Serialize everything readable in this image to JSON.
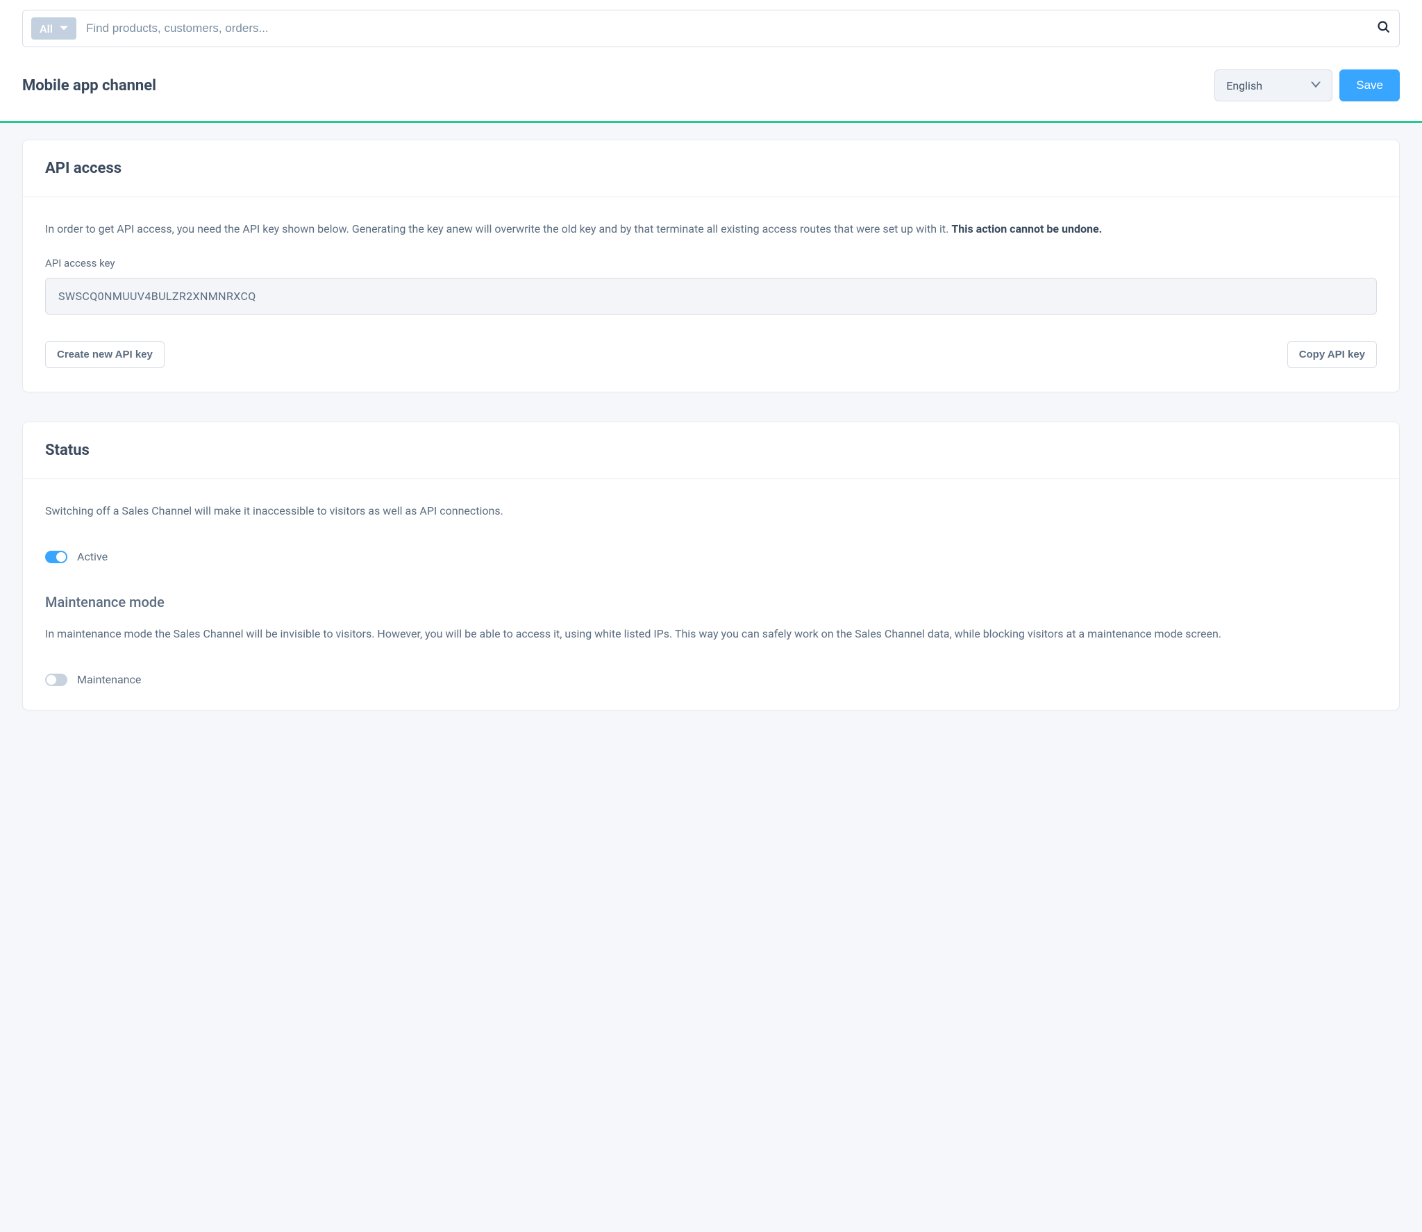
{
  "search": {
    "filter_label": "All",
    "placeholder": "Find products, customers, orders..."
  },
  "header": {
    "title": "Mobile app channel",
    "language": "English",
    "save_label": "Save"
  },
  "api_card": {
    "title": "API access",
    "description_prefix": "In order to get API access, you need the API key shown below. Generating the key anew will overwrite the old key and by that terminate all existing access routes that were set up with it. ",
    "description_bold": "This action cannot be undone.",
    "key_label": "API access key",
    "key_value": "SWSCQ0NMUUV4BULZR2XNMNRXCQ",
    "create_btn": "Create new API key",
    "copy_btn": "Copy API key"
  },
  "status_card": {
    "title": "Status",
    "description": "Switching off a Sales Channel will make it inaccessible to visitors as well as API connections.",
    "active_label": "Active",
    "active_on": true,
    "maint_title": "Maintenance mode",
    "maint_description": "In maintenance mode the Sales Channel will be invisible to visitors. However, you will be able to access it, using white listed IPs. This way you can safely work on the Sales Channel data, while blocking visitors at a maintenance mode screen.",
    "maint_label": "Maintenance",
    "maint_on": false
  }
}
